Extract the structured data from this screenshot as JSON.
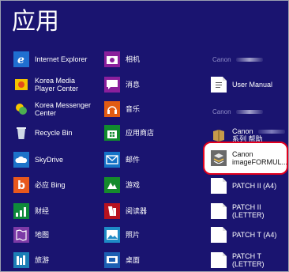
{
  "page": {
    "title": "应用"
  },
  "groups": {
    "canon1": "Canon",
    "canon2": "Canon"
  },
  "col1": [
    {
      "label": "Internet Explorer",
      "icon": "internet-explorer-icon",
      "color": "#1f6fd0"
    },
    {
      "label": "Korea Media Player Center",
      "icon": "media-player-icon",
      "color": "#2a2f86"
    },
    {
      "label": "Korea Messenger Center",
      "icon": "messenger-icon",
      "color": "#2a2f86"
    },
    {
      "label": "Recycle Bin",
      "icon": "recycle-bin-icon",
      "color": "#2a2f86"
    },
    {
      "label": "SkyDrive",
      "icon": "skydrive-icon",
      "color": "#1d73c9"
    },
    {
      "label": "必应 Bing",
      "icon": "bing-icon",
      "color": "#e8581d"
    },
    {
      "label": "财经",
      "icon": "finance-icon",
      "color": "#0e8a3a"
    },
    {
      "label": "地图",
      "icon": "maps-icon",
      "color": "#7c3aa6"
    },
    {
      "label": "旅游",
      "icon": "travel-icon",
      "color": "#1c7fb6"
    }
  ],
  "col2": [
    {
      "label": "相机",
      "icon": "camera-icon",
      "color": "#8a1f9c"
    },
    {
      "label": "消息",
      "icon": "messaging-icon",
      "color": "#8a1f9c"
    },
    {
      "label": "音乐",
      "icon": "music-icon",
      "color": "#e25b12"
    },
    {
      "label": "应用商店",
      "icon": "store-icon",
      "color": "#118a2e"
    },
    {
      "label": "邮件",
      "icon": "mail-icon",
      "color": "#1573c7"
    },
    {
      "label": "游戏",
      "icon": "games-icon",
      "color": "#158a2c"
    },
    {
      "label": "阅读器",
      "icon": "reader-icon",
      "color": "#b8121f"
    },
    {
      "label": "照片",
      "icon": "photos-icon",
      "color": "#1e8bc6"
    },
    {
      "label": "桌面",
      "icon": "desktop-icon",
      "color": "#1c5fb3"
    }
  ],
  "col3": [
    {
      "label": "User Manual",
      "icon": "manual-icon"
    },
    {
      "label": "Canon",
      "label2": "系列 帮助",
      "icon": "help-book-icon"
    },
    {
      "label": "Canon imageFORMUL...",
      "icon": "imageformula-icon"
    },
    {
      "label": "PATCH II (A4)",
      "icon": "document-icon"
    },
    {
      "label": "PATCH II (LETTER)",
      "icon": "document-icon"
    },
    {
      "label": "PATCH T (A4)",
      "icon": "document-icon"
    },
    {
      "label": "PATCH T (LETTER)",
      "icon": "document-icon"
    }
  ]
}
